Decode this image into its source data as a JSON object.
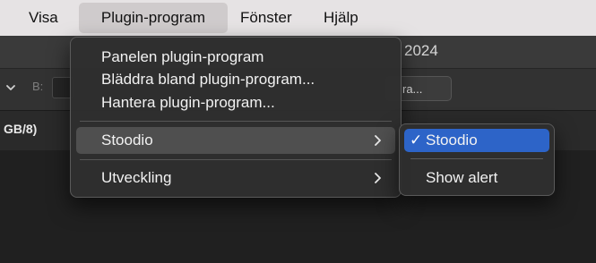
{
  "menubar": {
    "items": [
      {
        "label": "Visa"
      },
      {
        "label": "Plugin-program"
      },
      {
        "label": "Fönster"
      },
      {
        "label": "Hjälp"
      }
    ]
  },
  "background": {
    "document_title_fragment": "2024",
    "options_field_label": "B:",
    "options_button_fragment": "ra...",
    "tab_fragment": "GB/8)"
  },
  "plugin_menu": {
    "items": [
      {
        "label": "Panelen plugin-program"
      },
      {
        "label": "Bläddra bland plugin-program..."
      },
      {
        "label": "Hantera plugin-program..."
      },
      {
        "label": "Stoodio",
        "has_submenu": true,
        "highlighted": true
      },
      {
        "label": "Utveckling",
        "has_submenu": true
      }
    ]
  },
  "stoodio_submenu": {
    "items": [
      {
        "label": "Stoodio",
        "checked": true,
        "check_mark": "✓",
        "highlighted": true
      },
      {
        "label": "Show alert"
      }
    ]
  },
  "colors": {
    "menubar_bg": "#e6e3e4",
    "menu_bg": "#2e2e2e",
    "menu_highlight": "#4f4f4f",
    "submenu_highlight": "#2d64c8"
  }
}
